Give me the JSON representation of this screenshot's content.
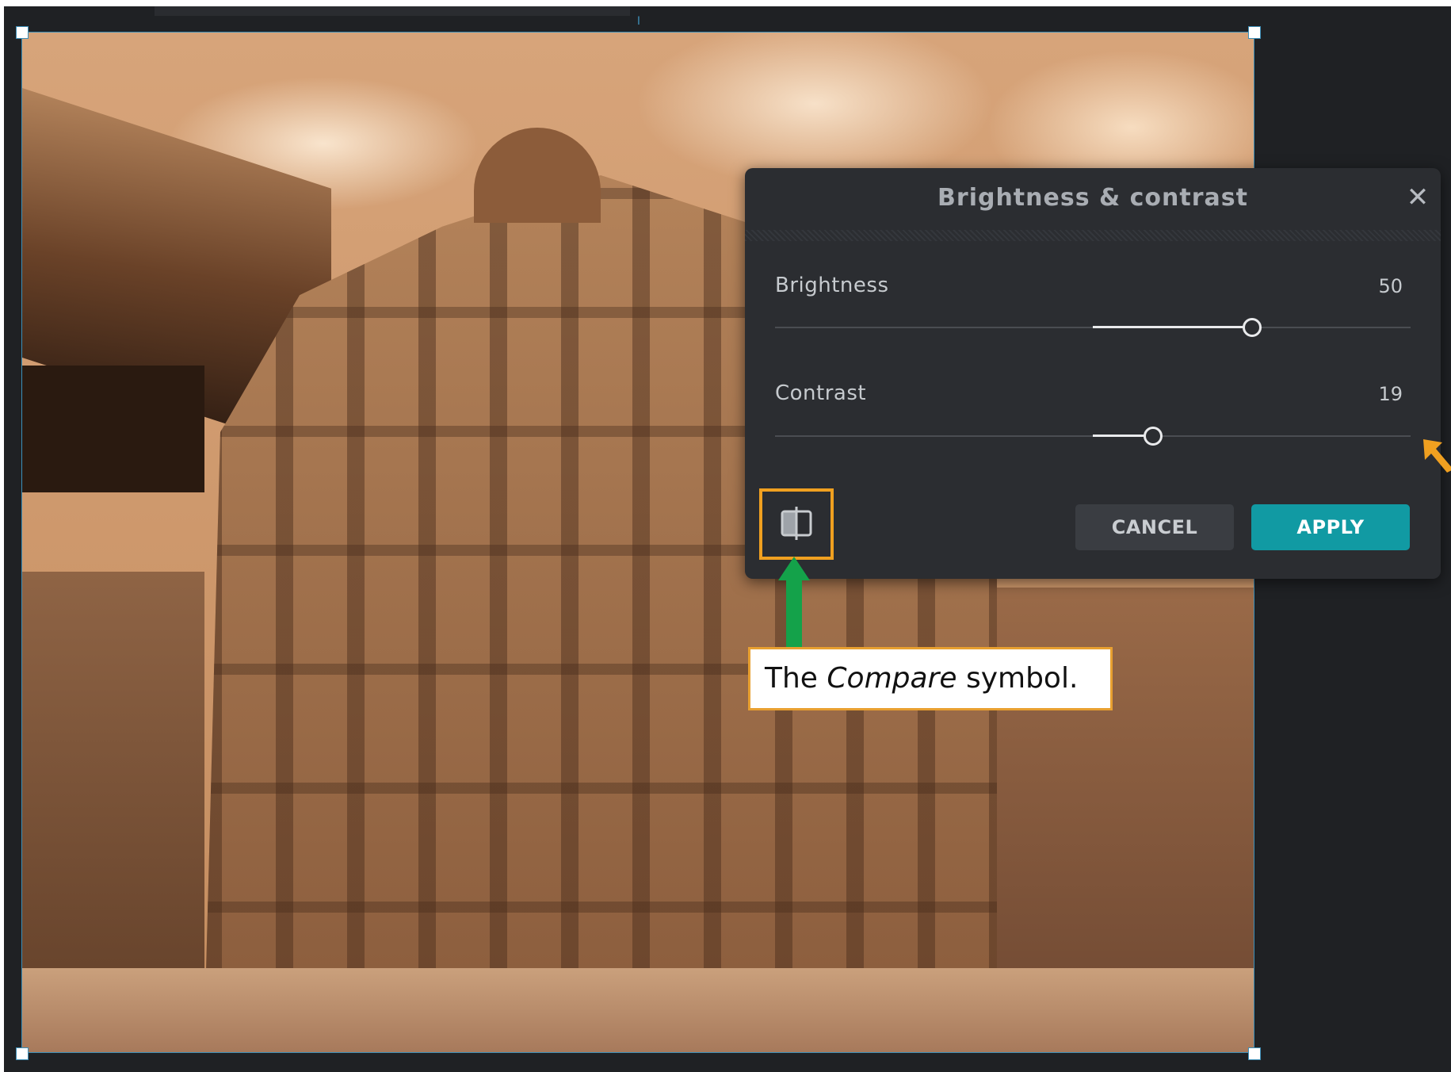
{
  "dialog": {
    "title": "Brightness & contrast",
    "close_glyph": "✕",
    "sliders": [
      {
        "label": "Brightness",
        "value": "50",
        "level": 50,
        "min": -100,
        "max": 100
      },
      {
        "label": "Contrast",
        "value": "19",
        "level": 19,
        "min": -100,
        "max": 100
      }
    ],
    "compare_icon": "compare-icon",
    "cancel_label": "CANCEL",
    "apply_label": "APPLY"
  },
  "annotation": {
    "callout_prefix": "The ",
    "callout_emphasis": "Compare",
    "callout_suffix": " symbol."
  },
  "colors": {
    "accent": "#119aa3",
    "dialog_bg": "#2b2d31",
    "workspace_bg": "#1f2124",
    "selection_border": "#3d8fb8",
    "highlight_orange": "#f0a020",
    "arrow_green": "#14a24a",
    "photo_tone": "sepia"
  }
}
